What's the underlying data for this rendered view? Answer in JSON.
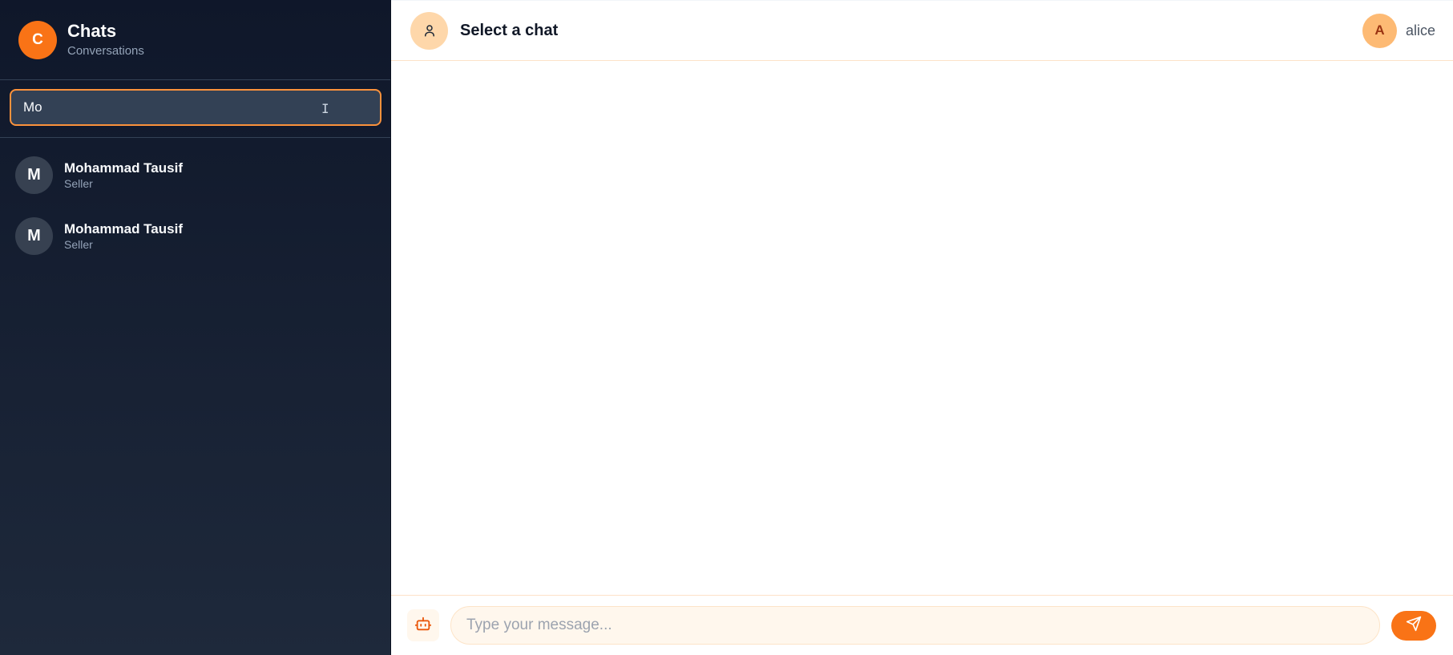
{
  "sidebar": {
    "brand_initial": "C",
    "title": "Chats",
    "subtitle": "Conversations",
    "search": {
      "value": "Mo"
    },
    "contacts": [
      {
        "initial": "M",
        "name": "Mohammad Tausif",
        "role": "Seller"
      },
      {
        "initial": "M",
        "name": "Mohammad Tausif",
        "role": "Seller"
      }
    ]
  },
  "header": {
    "title": "Select a chat",
    "user_initial": "A",
    "user_name": "alice"
  },
  "composer": {
    "placeholder": "Type your message..."
  },
  "colors": {
    "accent": "#f97316",
    "sidebar_bg": "#0f172a",
    "search_border": "#fb923c"
  },
  "icons": {
    "header_avatar": "user-icon",
    "composer_left": "bot-icon",
    "send": "send-icon"
  }
}
